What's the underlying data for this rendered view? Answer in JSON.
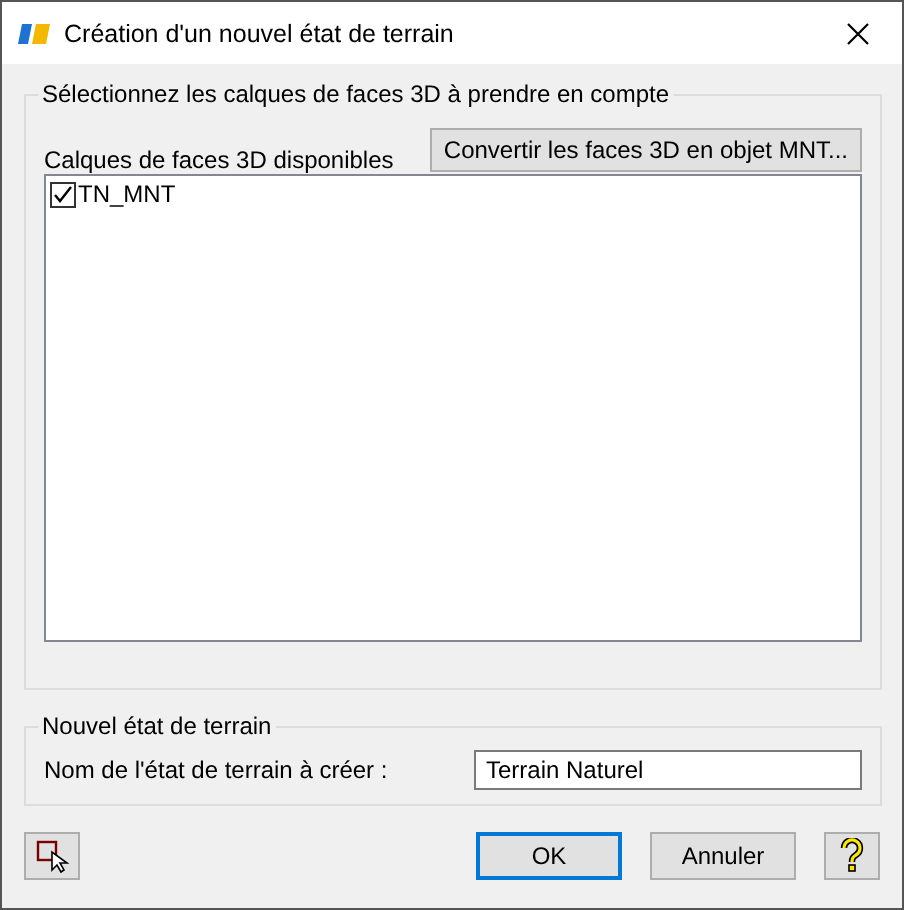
{
  "window": {
    "title": "Création d'un nouvel état de terrain"
  },
  "layers_group": {
    "legend": "Sélectionnez les calques de faces 3D à prendre en compte",
    "list_label": "Calques de faces 3D disponibles",
    "convert_button": "Convertir les faces 3D en objet MNT...",
    "items": [
      {
        "label": "TN_MNT",
        "checked": true
      }
    ]
  },
  "new_state_group": {
    "legend": "Nouvel état de terrain",
    "name_label": "Nom de l'état de terrain à créer :",
    "name_value": "Terrain Naturel"
  },
  "buttons": {
    "ok": "OK",
    "cancel": "Annuler"
  }
}
